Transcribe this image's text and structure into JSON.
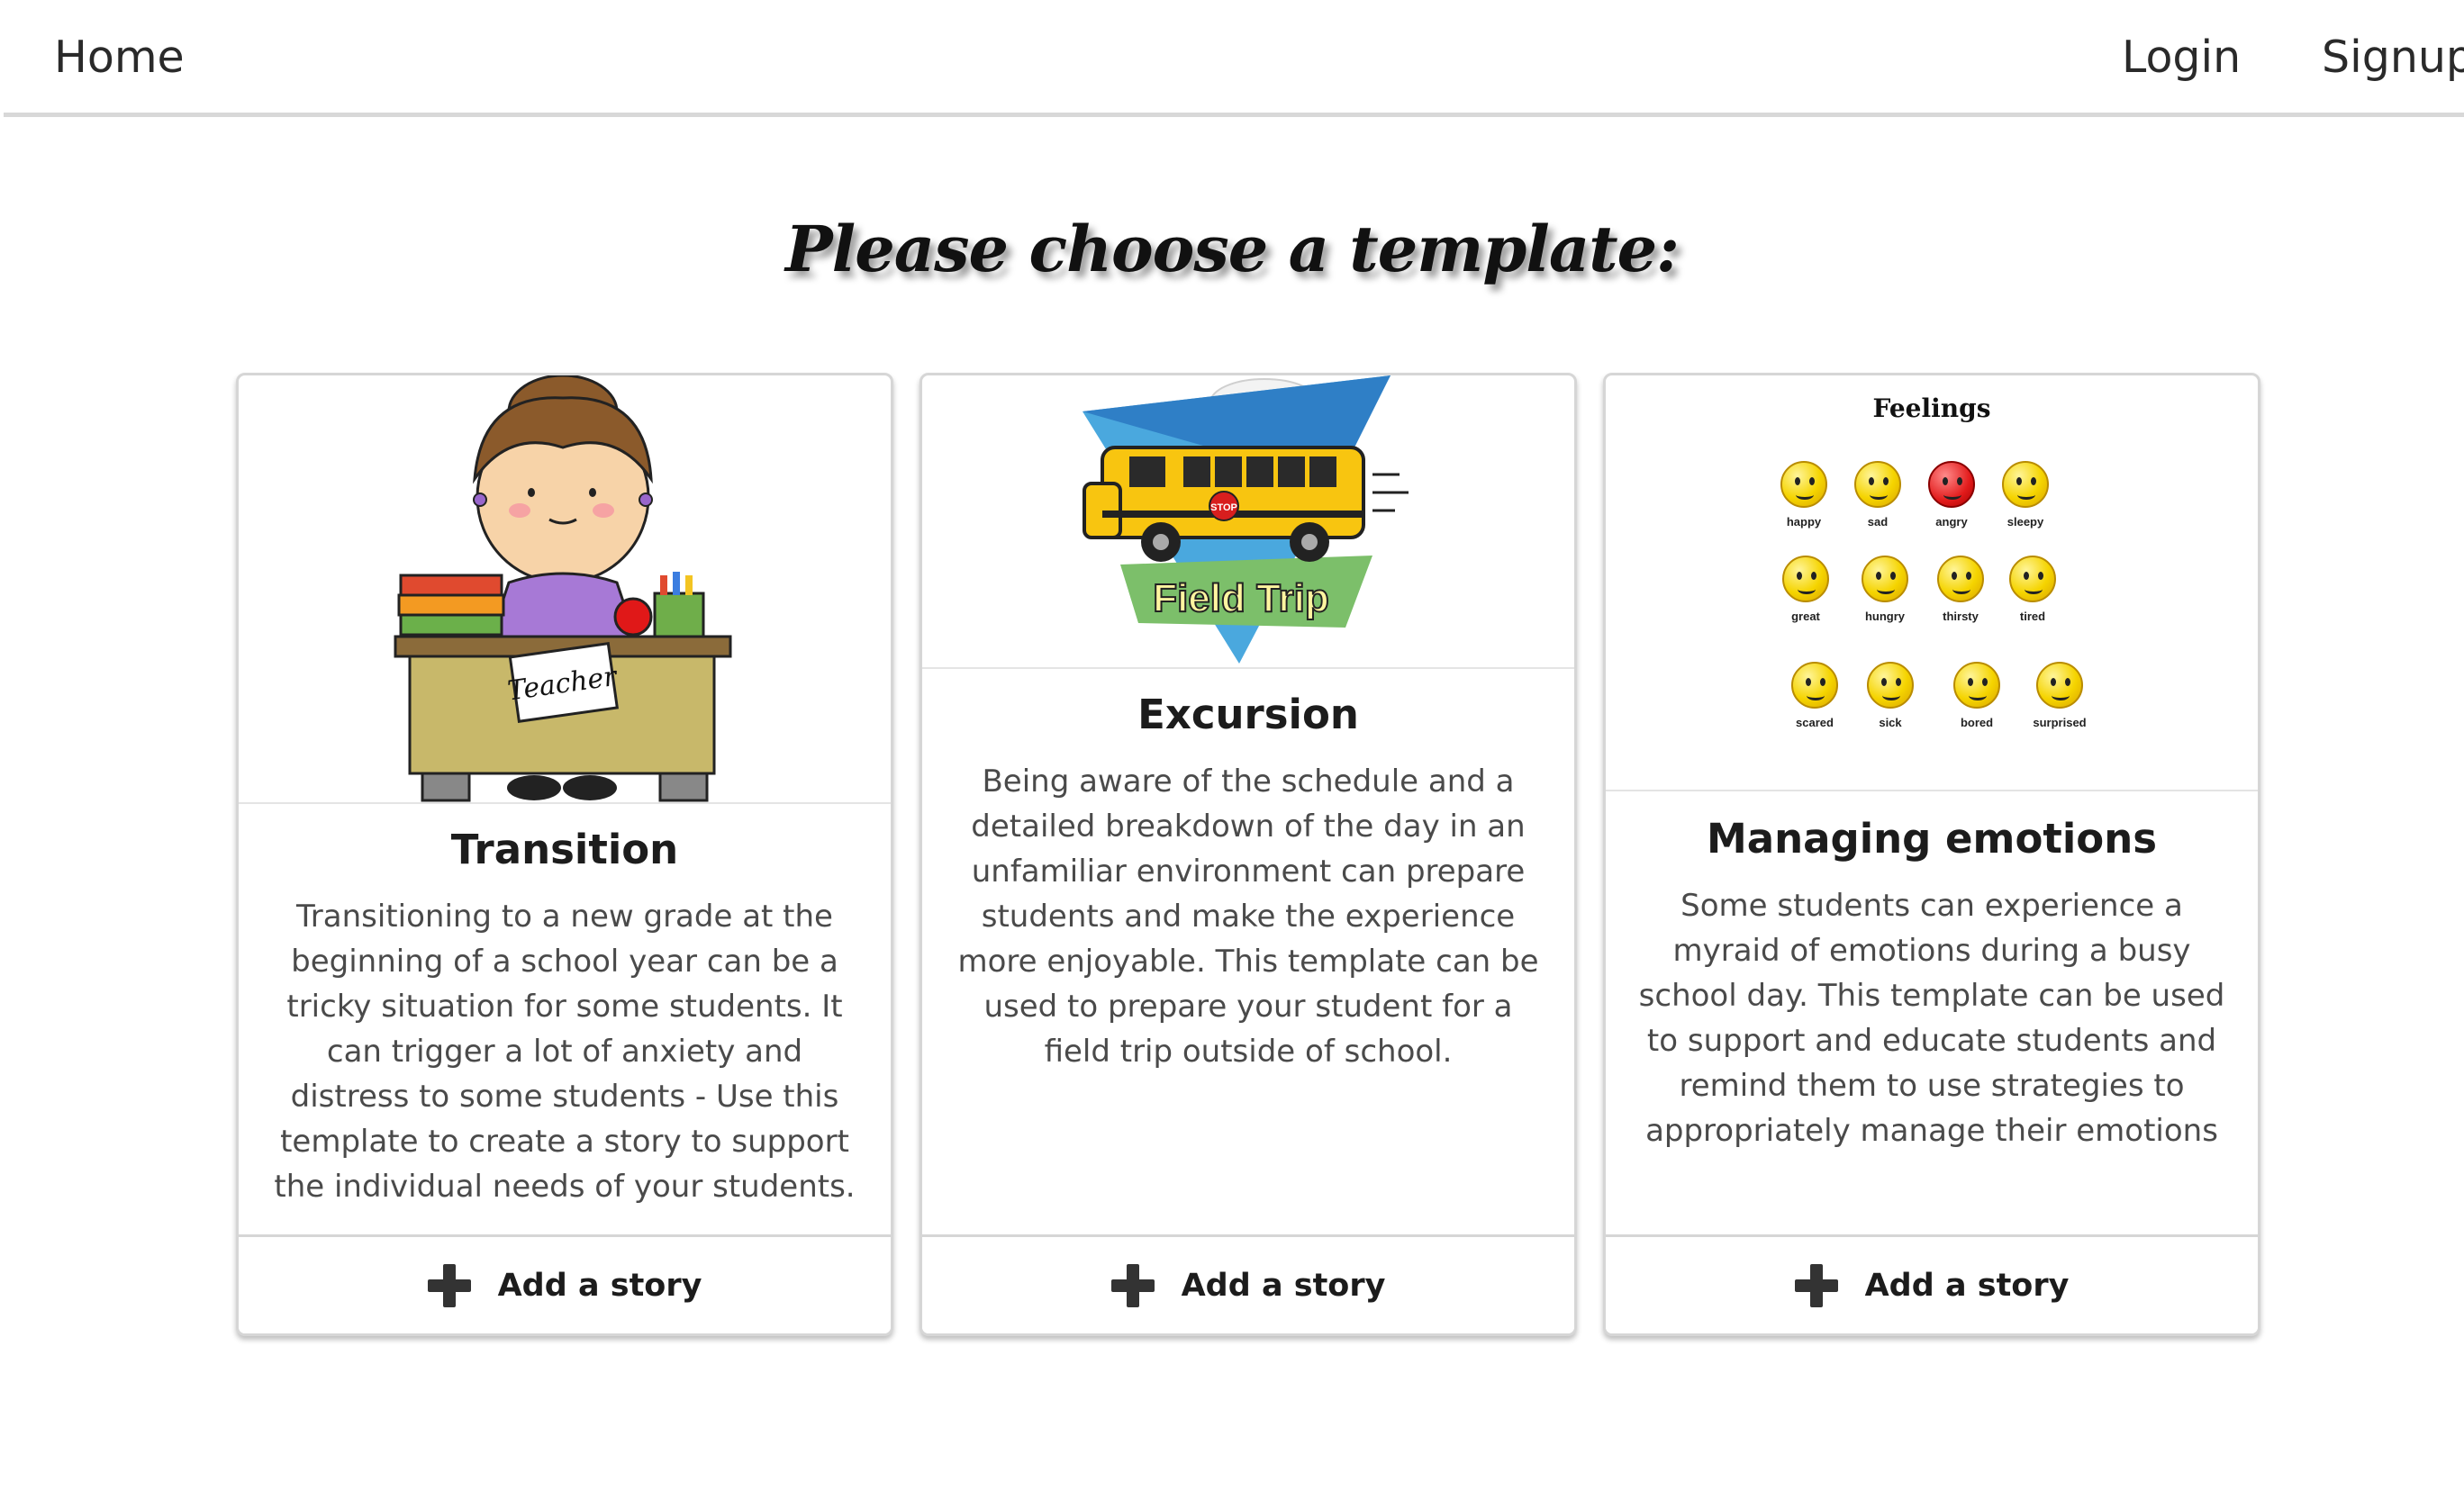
{
  "nav": {
    "home": "Home",
    "login": "Login",
    "signup": "Signup"
  },
  "page_title": "Please choose a template:",
  "cards": [
    {
      "title": "Transition",
      "description": "Transitioning to a new grade at the beginning of a school year can be a tricky situation for some students. It can trigger a lot of anxiety and distress to some students - Use this template to create a story to support the individual needs of your students.",
      "action": "Add a story",
      "image_label": "Teacher"
    },
    {
      "title": "Excursion",
      "description": "Being aware of the schedule and a detailed breakdown of the day in an unfamiliar environment can prepare students and make the experience more enjoyable. This template can be used to prepare your student for a field trip outside of school.",
      "action": "Add a story",
      "image_label": "Field Trip",
      "sign_label": "STOP"
    },
    {
      "title": "Managing emotions",
      "description": "Some students can experience a myraid of emotions during a busy school day. This template can be used to support and educate students and remind them to use strategies to appropriately manage their emotions",
      "action": "Add a story",
      "image_title": "Feelings",
      "feelings": [
        "happy",
        "sad",
        "angry",
        "sleepy",
        "great",
        "hungry",
        "thirsty",
        "tired",
        "scared",
        "sick",
        "bored",
        "surprised"
      ]
    }
  ]
}
